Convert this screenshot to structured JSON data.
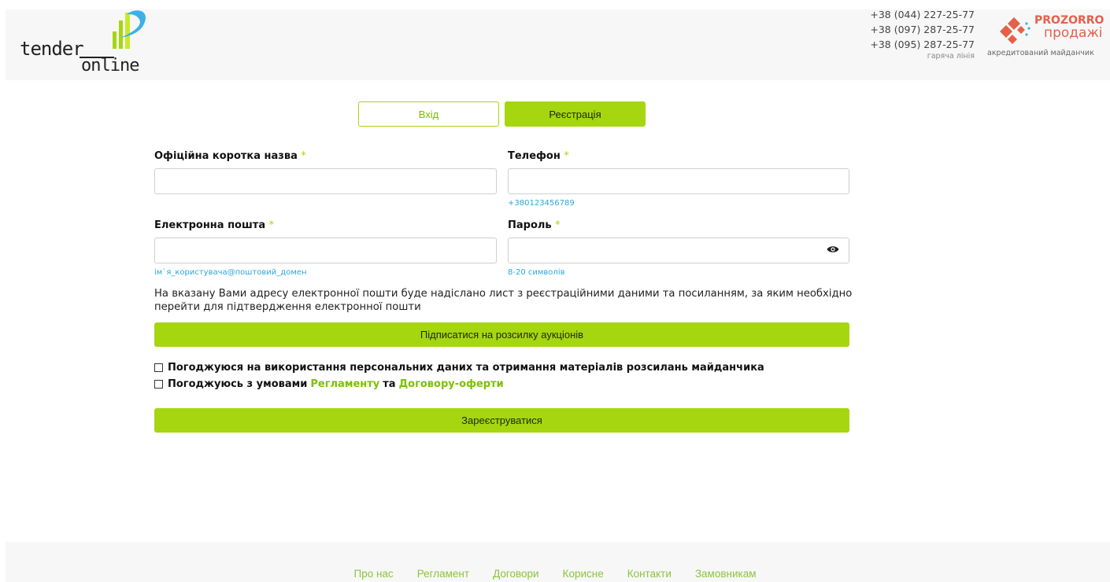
{
  "brand": {
    "logo_text": "tenderonline",
    "accent_color": "#a5d610",
    "link_color": "#2aa8d6"
  },
  "header": {
    "phones": [
      "+38 (044) 227-25-77",
      "+38 (097) 287-25-77",
      "+38 (095) 287-25-77"
    ],
    "hotline_label": "гаряча лінія",
    "prozorro": {
      "line1": "PROZORRO",
      "line2": "продажі",
      "caption": "акредитований майданчик"
    }
  },
  "tabs": {
    "login": "Вхід",
    "register": "Реєстрація"
  },
  "form": {
    "short_name": {
      "label": "Офіційна коротка назва",
      "required": "*",
      "value": ""
    },
    "phone": {
      "label": "Телефон",
      "required": "*",
      "value": "",
      "hint": "+380123456789"
    },
    "email": {
      "label": "Електронна пошта",
      "required": "*",
      "value": "",
      "hint": "ім`я_користувача@поштовий_домен"
    },
    "password": {
      "label": "Пароль",
      "required": "*",
      "value": "",
      "hint": "8-20 символів",
      "toggle_icon": "eye-icon"
    },
    "notice": "На вказану Вами адресу електронної пошти буде надіслано лист з реєстраційними даними та посиланням, за яким необхідно перейти для підтвердження електронної пошти",
    "subscribe_button": "Підписатися на розсилку аукціонів",
    "consent_personal": "Погоджуюся на використання персональних даних та отримання матеріалів розсилань майданчика",
    "consent_terms_prefix": "Погоджуюсь з умовами",
    "consent_terms_link1": "Регламенту",
    "consent_terms_and": "та",
    "consent_terms_link2": "Договору-оферти",
    "submit_button": "Зареєструватися"
  },
  "footer": {
    "links": [
      "Про нас",
      "Регламент",
      "Договори",
      "Корисне",
      "Контакти",
      "Замовникам"
    ]
  }
}
